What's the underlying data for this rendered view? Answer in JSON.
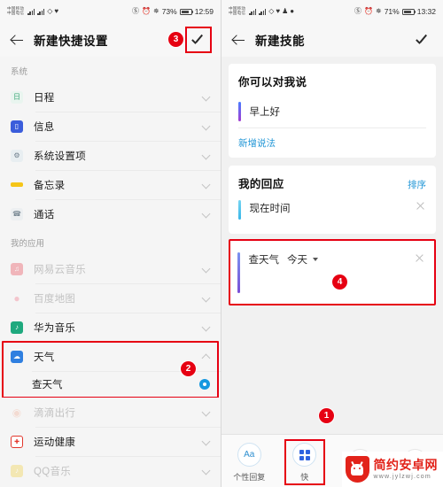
{
  "left_screen": {
    "status_bar": {
      "carrier_line1": "中国移动",
      "carrier_line2": "中国电信",
      "battery": "73%",
      "time": "12:59",
      "icons": [
        "signal-icon",
        "signal-icon",
        "wifi-icon",
        "vpn-icon",
        "mute-icon",
        "alarm-icon",
        "bluetooth-icon",
        "battery-icon"
      ]
    },
    "appbar": {
      "back": "back-arrow-icon",
      "title": "新建快捷设置",
      "confirm": "check-icon"
    },
    "groups": [
      {
        "header": "系统",
        "items": [
          {
            "label": "日程",
            "icon": "calendar-icon",
            "color": "#3aa676",
            "dim": false,
            "expanded": false
          },
          {
            "label": "信息",
            "icon": "message-icon",
            "color": "#3b5ddb",
            "dim": false,
            "expanded": false
          },
          {
            "label": "系统设置项",
            "icon": "settings-icon",
            "color": "#6f7f8c",
            "dim": false,
            "expanded": false
          },
          {
            "label": "备忘录",
            "icon": "notes-icon",
            "color": "#f5c518",
            "dim": false,
            "expanded": false
          },
          {
            "label": "通话",
            "icon": "phone-icon",
            "color": "#8a8a8a",
            "dim": false,
            "expanded": false
          }
        ]
      },
      {
        "header": "我的应用",
        "items": [
          {
            "label": "网易云音乐",
            "icon": "netease-music-icon",
            "color": "#e8505b",
            "dim": true,
            "expanded": false
          },
          {
            "label": "百度地图",
            "icon": "baidu-map-icon",
            "color": "#f07a8c",
            "dim": true,
            "expanded": false
          },
          {
            "label": "华为音乐",
            "icon": "huawei-music-icon",
            "color": "#1fa97e",
            "dim": false,
            "expanded": false
          },
          {
            "label": "天气",
            "icon": "weather-icon",
            "color": "#2f7fe0",
            "dim": false,
            "expanded": true,
            "highlighted": true,
            "sub_item": {
              "label": "查天气",
              "selected": true
            }
          },
          {
            "label": "滴滴出行",
            "icon": "didi-icon",
            "color": "#f09a7a",
            "dim": true,
            "expanded": false
          },
          {
            "label": "运动健康",
            "icon": "health-icon",
            "color": "#e2372c",
            "dim": false,
            "expanded": false
          },
          {
            "label": "QQ音乐",
            "icon": "qq-music-icon",
            "color": "#f2d14a",
            "dim": true,
            "expanded": false
          }
        ]
      }
    ],
    "badges": [
      {
        "number": "3",
        "target": "confirm-check"
      },
      {
        "number": "2",
        "target": "weather-row"
      }
    ]
  },
  "right_screen": {
    "status_bar": {
      "carrier_line1": "中国移动",
      "carrier_line2": "中国电信",
      "battery": "71%",
      "time": "13:32"
    },
    "appbar": {
      "back": "back-arrow-icon",
      "title": "新建技能",
      "confirm": "check-icon"
    },
    "say_card": {
      "title": "你可以对我说",
      "phrase": "早上好",
      "add_link": "新增说法"
    },
    "response_card": {
      "title": "我的回应",
      "sort_action": "排序",
      "items": [
        {
          "text": "现在时间",
          "has_close": true
        }
      ]
    },
    "highlighted_response": {
      "text": "查天气",
      "chip": "今天",
      "has_dropdown": true,
      "has_close": true,
      "blurred_value": true
    },
    "tabbar": {
      "tabs": [
        {
          "label": "个性回复",
          "icon": "aa-text-icon"
        },
        {
          "label": "快",
          "icon": "grid-apps-icon",
          "highlighted": true
        },
        {
          "label": "",
          "icon": "wave-icon"
        },
        {
          "label": "",
          "icon": "alarm-icon"
        }
      ]
    },
    "badges": [
      {
        "number": "1",
        "target": "tab-quick"
      },
      {
        "number": "4",
        "target": "weather-response-card"
      }
    ]
  },
  "watermark": {
    "title": "简约安卓网",
    "url": "www.jylzwj.com",
    "icon": "android-shield-icon"
  }
}
